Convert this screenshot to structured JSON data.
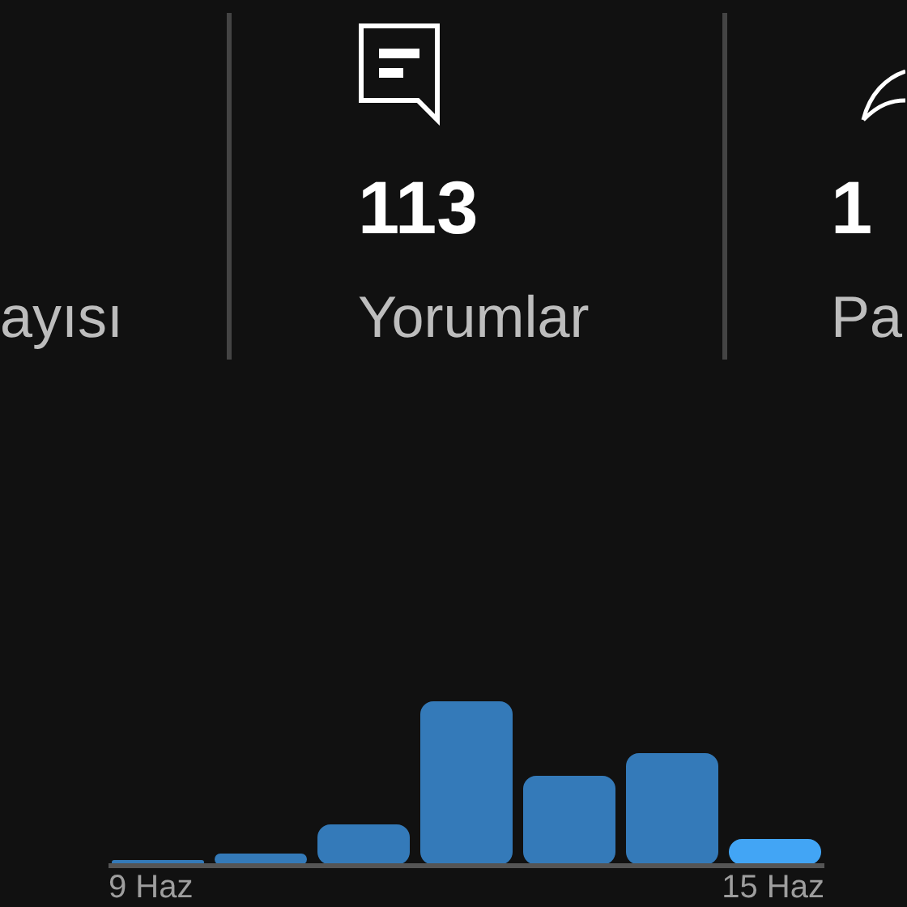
{
  "stats": [
    {
      "label": "ayısı"
    },
    {
      "kind": "comment",
      "value": "113",
      "label": "Yorumlar"
    },
    {
      "kind": "leaf",
      "value": "1",
      "label": "Pa"
    }
  ],
  "chart": {
    "axis_labels": [
      "9 Haz",
      "15 Haz"
    ]
  }
}
